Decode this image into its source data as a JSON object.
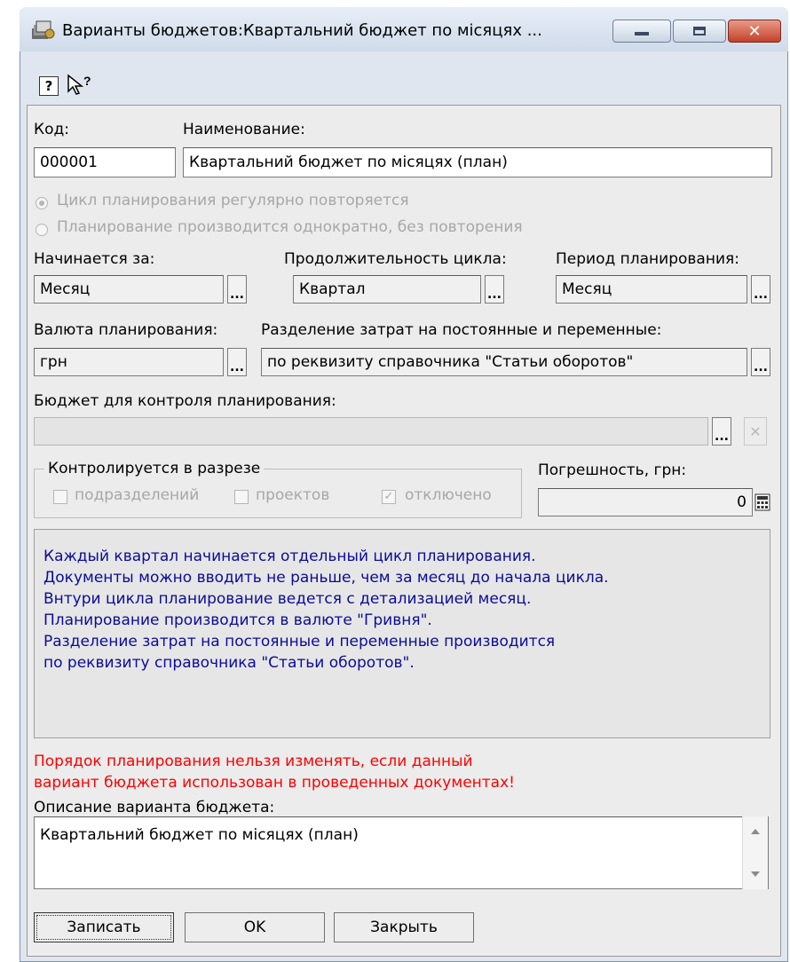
{
  "window": {
    "title": "Варианты бюджетов:Квартальний бюджет по місяцях ..."
  },
  "toolbar": {
    "help_icon": "help-question-icon",
    "whats_this_icon": "whats-this-pointer-icon"
  },
  "form": {
    "code_label": "Код:",
    "code_value": "000001",
    "name_label": "Наименование:",
    "name_value": "Квартальний бюджет по місяцях (план)",
    "radio_cycle_repeat": "Цикл планирования регулярно повторяется",
    "radio_once": "Планирование производится однократно, без повторения",
    "starts_label": "Начинается за:",
    "starts_value": "Месяц",
    "duration_label": "Продолжительность цикла:",
    "duration_value": "Квартал",
    "period_label": "Период планирования:",
    "period_value": "Месяц",
    "currency_label": "Валюта планирования:",
    "currency_value": "грн",
    "split_label": "Разделение затрат на постоянные и переменные:",
    "split_value": "по реквизиту справочника \"Статьи оборотов\"",
    "control_budget_label": "Бюджет для контроля планирования:",
    "control_budget_value": "",
    "controlled_group_label": "Контролируется в разрезе",
    "cb_departments": "подразделений",
    "cb_projects": "проектов",
    "cb_disabled": "отключено",
    "error_label": "Погрешность, грн:",
    "error_value": "0",
    "dots": "...",
    "clear": "✕"
  },
  "info_lines": [
    "Каждый квартал начинается отдельный цикл планирования.",
    "Документы можно вводить не раньше, чем за месяц до начала цикла.",
    "Внтури цикла планирование ведется с детализацией месяц.",
    "Планирование производится в валюте \"Гривня\".",
    "Разделение затрат на постоянные и переменные производится",
    "по реквизиту справочника \"Статьи оборотов\"."
  ],
  "warning_lines": [
    "Порядок планирования нельзя изменять, если данный",
    "вариант бюджета использован в проведенных документах!"
  ],
  "description": {
    "label": "Описание варианта бюджета:",
    "value": "Квартальний бюджет по місяцях (план)"
  },
  "buttons": {
    "save": "Записать",
    "ok": "OK",
    "close": "Закрыть"
  },
  "colors": {
    "info_text": "#0b0b9b",
    "warning_text": "#ff0000"
  }
}
